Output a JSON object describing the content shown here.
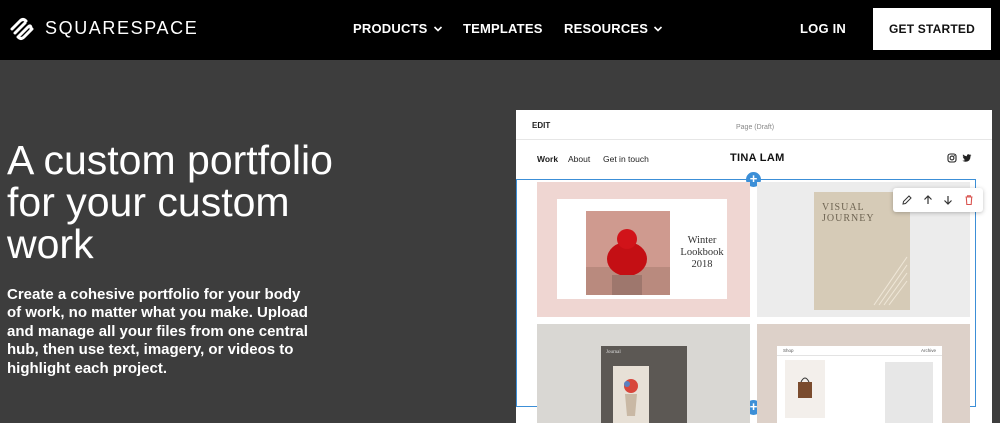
{
  "brand": {
    "name": "SQUARESPACE",
    "logo_icon": "squarespace-logo-icon"
  },
  "nav": {
    "products": "PRODUCTS",
    "templates": "TEMPLATES",
    "resources": "RESOURCES",
    "login": "LOG IN",
    "get_started": "GET STARTED"
  },
  "hero": {
    "title": "A custom portfolio for your custom work",
    "subtitle": "Create a cohesive portfolio for your body of work, no matter what you make. Upload and manage all your files from one central hub, then use text, imagery, or videos to highlight each project."
  },
  "mockup": {
    "edit_label": "EDIT",
    "page_status": "Page (Draft)",
    "nav_items": [
      "Work",
      "About",
      "Get in touch"
    ],
    "site_title": "TINA LAM",
    "social_icons": [
      "instagram-icon",
      "twitter-icon"
    ],
    "tile1_text": "Winter Lookbook 2018",
    "tile2_text": "VISUAL JOURNEY",
    "tile3_label": "Journal",
    "tile4_left_label": "Shop",
    "tile4_right_label": "Archive",
    "toolbar_icons": [
      "pencil-icon",
      "arrow-up-icon",
      "arrow-down-icon",
      "trash-icon"
    ]
  },
  "colors": {
    "nav_bg": "#000000",
    "page_bg": "#3d3d3d",
    "accent_blue": "#3c8fd7",
    "trash_red": "#d9534f"
  }
}
